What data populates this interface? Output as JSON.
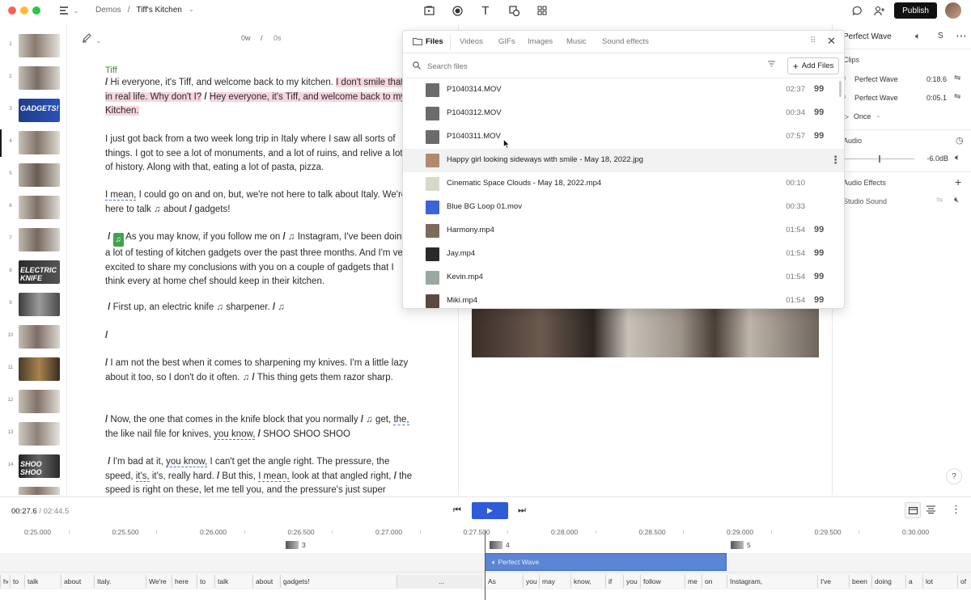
{
  "topbar": {
    "breadcrumb_parent": "Demos",
    "breadcrumb_sep": "/",
    "breadcrumb_current": "Tiff's Kitchen",
    "publish_label": "Publish"
  },
  "filmstrip": {
    "scenes": [
      {
        "num": "1"
      },
      {
        "num": "2"
      },
      {
        "num": "3",
        "label": "GADGETS!"
      },
      {
        "num": "4"
      },
      {
        "num": "5"
      },
      {
        "num": "6"
      },
      {
        "num": "7"
      },
      {
        "num": "8",
        "label": "ELECTRIC KNIFE"
      },
      {
        "num": "9"
      },
      {
        "num": "10"
      },
      {
        "num": "11"
      },
      {
        "num": "12"
      },
      {
        "num": "13"
      },
      {
        "num": "14",
        "label": "SHOO SHOO"
      },
      {
        "num": "15"
      }
    ]
  },
  "editor": {
    "duration_words": "0w",
    "duration_sep": "/",
    "duration_secs": "0s",
    "speaker": "Tiff",
    "p1_a": "Hi everyone, it's Tiff, and welcome back to my kitchen.",
    "p1_b": "I don't smile that in real life. Why don't I?",
    "p1_c": "Hey everyone, it's Tiff, and welcome back to my Kitchen.",
    "p2": "I just got back from a two week long trip in Italy where I saw all sorts of things. I got to see a lot of monuments, and a lot of ruins, and relive a lot of history. Along with that, eating a lot of pasta, pizza.",
    "p3_a": "I mean,",
    "p3_b": "I could go on and on, but, we're not here to talk about Italy. We're here to talk",
    "p3_c": "about",
    "p3_d": "gadgets!",
    "p4_a": "As you may know, if you follow me on",
    "p4_b": "Instagram, I've been doing a lot of testing of kitchen gadgets over the past three months. And I'm very excited to share my conclusions with you on a couple of gadgets that I think every at home chef should keep in their kitchen.",
    "p5_a": "First up, an electric knife",
    "p5_b": "sharpener.",
    "p7_a": "I am not the best when it comes to sharpening my knives. I'm a little lazy about it too, so I don't do it often.",
    "p7_b": "This thing gets them razor sharp.",
    "p8_a": "Now, the one that comes in the knife block that you normally",
    "p8_b": "get,",
    "p8_c": "the,",
    "p8_d": "the like nail file for knives,",
    "p8_e": "you know,",
    "p8_f": "SHOO SHOO SHOO",
    "p9_a": "I'm bad at it,",
    "p9_b": "you know,",
    "p9_c": "I can't get the angle right. The pressure, the speed,",
    "p9_d": "it's,",
    "p9_e": "it's, really hard.",
    "p9_f": "But this,",
    "p9_g": "I mean,",
    "p9_h": "look at that angled right,",
    "p9_i": "the speed is right on these, let me tell you, and the pressure's just super"
  },
  "popup": {
    "tabs": [
      "Files",
      "Videos",
      "GIFs",
      "Images",
      "Music",
      "Sound effects"
    ],
    "search_placeholder": "Search files",
    "add_files_label": "Add Files",
    "files": [
      {
        "name": "P1040314.MOV",
        "duration": "02:37",
        "quote": "99"
      },
      {
        "name": "P1040312.MOV",
        "duration": "00:34",
        "quote": "99"
      },
      {
        "name": "P1040311.MOV",
        "duration": "07:57",
        "quote": "99"
      },
      {
        "name": "Happy girl looking sideways with smile - May 18, 2022.jpg",
        "duration": "",
        "quote": ""
      },
      {
        "name": "Cinematic Space Clouds - May 18, 2022.mp4",
        "duration": "00:10",
        "quote": ""
      },
      {
        "name": "Blue BG Loop 01.mov",
        "duration": "00:33",
        "quote": ""
      },
      {
        "name": "Harmony.mp4",
        "duration": "01:54",
        "quote": "99"
      },
      {
        "name": "Jay.mp4",
        "duration": "01:54",
        "quote": "99"
      },
      {
        "name": "Kevin.mp4",
        "duration": "01:54",
        "quote": "99"
      },
      {
        "name": "Miki.mp4",
        "duration": "01:54",
        "quote": "99"
      }
    ],
    "thumb_colors": [
      "#6b6b6b",
      "#6b6b6b",
      "#6b6b6b",
      "#b08a6e",
      "#d8d8c8",
      "#3b64d8",
      "#7d6a5a",
      "#2a2a2a",
      "#9aa8a0",
      "#5a4a42"
    ]
  },
  "rpanel": {
    "title": "Perfect Wave",
    "s_label": "S",
    "clips_header": "Clips",
    "clips": [
      {
        "name": "Perfect Wave",
        "time": "0:18.6"
      },
      {
        "name": "Perfect Wave",
        "time": "0:05.1"
      }
    ],
    "once_label": "Once",
    "audio_header": "Audio",
    "audio_level": "-6.0dB",
    "audio_level_fraction": 0.5,
    "effects_header": "Audio Effects",
    "studio_sound": "Studio Sound",
    "help_label": "?"
  },
  "transport": {
    "current": "00:27.6",
    "sep": "/",
    "total": "02:44.5"
  },
  "timeline": {
    "ticks": [
      "0:25.000",
      "0:25.500",
      "0:26.000",
      "0:26.500",
      "0:27.000",
      "0:27.500",
      "0:28.000",
      "0:28.500",
      "0:29.000",
      "0:29.500",
      "0:30.000"
    ],
    "scene_markers": [
      "3",
      "4",
      "5"
    ],
    "wave_label": "Perfect Wave",
    "words": [
      "he",
      "to",
      "talk",
      "about",
      "Italy.",
      "We're",
      "here",
      "to",
      "talk",
      "about",
      "gadgets!",
      "...",
      "As",
      "you",
      "may",
      "know,",
      "if",
      "you",
      "follow",
      "me",
      "on",
      "Instagram,",
      "I've",
      "been",
      "doing",
      "a",
      "lot",
      "of"
    ]
  },
  "colors": {
    "accent": "#2e5bd8",
    "highlight": "#f6d5dd",
    "speaker": "#3a8a3a",
    "wave": "#5a86d4"
  }
}
